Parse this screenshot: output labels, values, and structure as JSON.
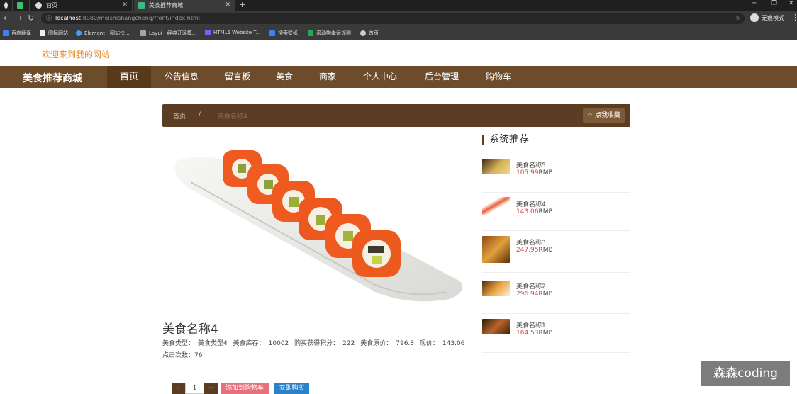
{
  "browser": {
    "tabs": [
      {
        "title": "首页",
        "active": false
      },
      {
        "title": "美食推荐商城",
        "active": true
      }
    ],
    "url_host": "localhost",
    "url_path": ":8080/meishishangcheng/front/index.html",
    "incognito_label": "无痕模式",
    "bookmarks": [
      "百度翻译",
      "Element - 网站快...",
      "Layui - 经典开源模...",
      "HTML5 Website T...",
      "搜索壁纸",
      "滚动狗幸运规则",
      "首页",
      "图标网站"
    ]
  },
  "site": {
    "welcome": "欢迎来到我的网站",
    "brand": "美食推荐商城",
    "nav": [
      "首页",
      "公告信息",
      "留言板",
      "美食",
      "商家",
      "个人中心",
      "后台管理",
      "购物车"
    ]
  },
  "breadcrumb": {
    "home": "首页",
    "separator": "/",
    "current": "美食名称4",
    "favorite_label": "点我收藏"
  },
  "product": {
    "name": "美食名称4",
    "meta": [
      {
        "label": "美食类型：",
        "value": "美食类型4"
      },
      {
        "label": "美食库存：",
        "value": "10002"
      },
      {
        "label": "购买获得积分：",
        "value": "222"
      },
      {
        "label": "美食原价：",
        "value": "796.8"
      },
      {
        "label": "现价：",
        "value": "143.06"
      }
    ],
    "clicks_label": "点击次数：",
    "clicks_value": "76",
    "quantity": "1",
    "qty_minus": "-",
    "qty_plus": "+",
    "add_to_cart": "添加到购物车",
    "buy_now": "立即购买"
  },
  "recommend": {
    "title": "系统推荐",
    "currency": "RMB",
    "items": [
      {
        "name": "美食名称5",
        "price": "105.99"
      },
      {
        "name": "美食名称4",
        "price": "143.06"
      },
      {
        "name": "美食名称3",
        "price": "247.95"
      },
      {
        "name": "美食名称2",
        "price": "296.94"
      },
      {
        "name": "美食名称1",
        "price": "164.53"
      }
    ]
  },
  "watermark": "森森coding"
}
